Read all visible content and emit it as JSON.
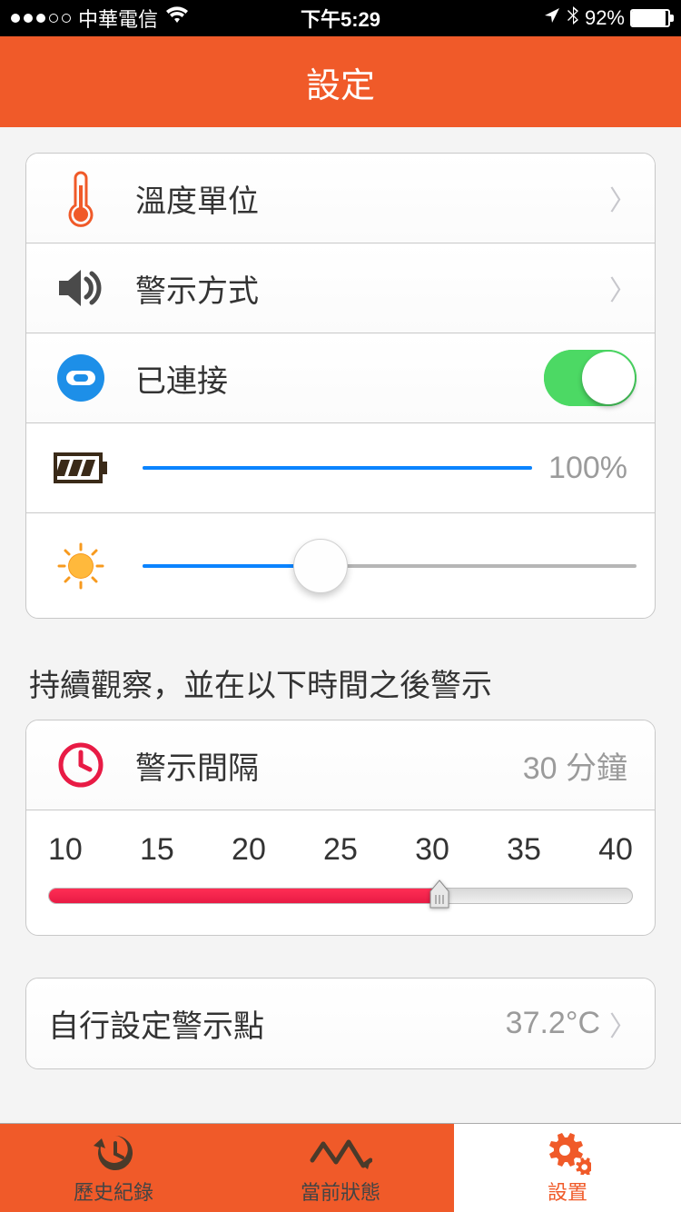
{
  "status": {
    "carrier": "中華電信",
    "time": "下午5:29",
    "battery_pct": "92%"
  },
  "header": {
    "title": "設定"
  },
  "settings": {
    "temperature_unit_label": "溫度單位",
    "alert_mode_label": "警示方式",
    "connected_label": "已連接",
    "battery_value": "100%"
  },
  "interval": {
    "section_label": "持續觀察，並在以下時間之後警示",
    "row_label": "警示間隔",
    "row_value": "30 分鐘",
    "ticks": [
      "10",
      "15",
      "20",
      "25",
      "30",
      "35",
      "40"
    ]
  },
  "custom_point": {
    "label": "自行設定警示點",
    "value": "37.2°C"
  },
  "tabs": {
    "history": "歷史紀錄",
    "current": "當前狀態",
    "settings": "設置"
  }
}
